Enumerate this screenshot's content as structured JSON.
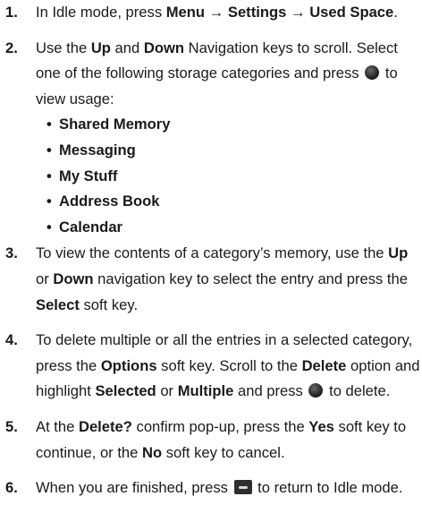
{
  "steps": [
    {
      "num": "1.",
      "t1": "In Idle mode, press ",
      "b1": "Menu",
      "t2": " → ",
      "b2": "Settings",
      "t3": " → ",
      "b3": "Used Space",
      "t4": "."
    },
    {
      "num": "2.",
      "t1": "Use the ",
      "b1": "Up",
      "t2": " and ",
      "b2": "Down",
      "t3": " Navigation keys to scroll. Select one of the following storage categories and press ",
      "t4": " to view usage:",
      "icon": "center-select-key-icon",
      "categories": [
        "Shared Memory",
        "Messaging",
        "My Stuff",
        "Address Book",
        "Calendar"
      ]
    },
    {
      "num": "3.",
      "t1": "To view the contents of a category’s memory, use the ",
      "b1": "Up",
      "t2": " or ",
      "b2": "Down",
      "t3": " navigation key to select the entry and press the ",
      "b3": "Select",
      "t4": " soft key."
    },
    {
      "num": "4.",
      "t1": "To delete multiple or all the entries in a selected category, press the ",
      "b1": "Options",
      "t2": " soft key. Scroll to the ",
      "b2": "Delete",
      "t3": " option and highlight ",
      "b3": "Selected",
      "t4": " or ",
      "b4": "Multiple",
      "t5": " and press ",
      "t6": " to delete.",
      "icon": "center-select-key-icon"
    },
    {
      "num": "5.",
      "t1": "At the ",
      "b1": "Delete?",
      "t2": " confirm pop-up, press the ",
      "b2": "Yes",
      "t3": " soft key to continue, or the ",
      "b3": "No",
      "t4": " soft key to cancel."
    },
    {
      "num": "6.",
      "t1": "When you are finished, press ",
      "t2": " to return to Idle mode.",
      "icon": "end-key-icon"
    }
  ],
  "bullet": "•"
}
